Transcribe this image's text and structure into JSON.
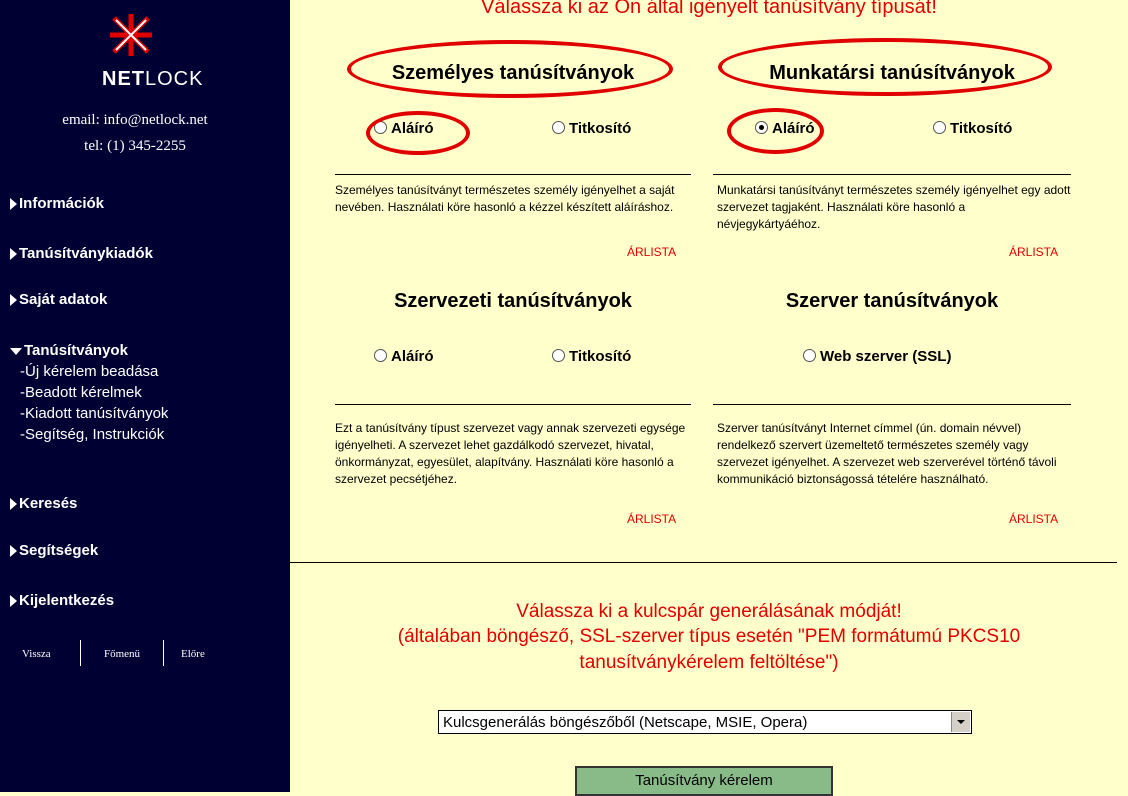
{
  "sidebar": {
    "logo_text_bold": "NET",
    "logo_text_light": "LOCK",
    "email": "email: info@netlock.net",
    "tel": "tel: (1) 345-2255",
    "nav": [
      {
        "label": "Információk"
      },
      {
        "label": "Tanúsítványkiadók"
      },
      {
        "label": "Saját adatok"
      },
      {
        "label": "Tanúsítványok"
      },
      {
        "label": "Keresés"
      },
      {
        "label": "Segítségek"
      },
      {
        "label": "Kijelentkezés"
      }
    ],
    "subnav": [
      {
        "label": "-Új kérelem beadása"
      },
      {
        "label": "-Beadott kérelmek"
      },
      {
        "label": "-Kiadott tanúsítványok"
      },
      {
        "label": "-Segítség, Instrukciók"
      }
    ],
    "bottom": {
      "back": "Vissza",
      "home": "Főmenü",
      "forward": "Előre"
    }
  },
  "main": {
    "heading": "Válassza ki az Ön által igényelt tanúsítvány típusát!",
    "sections": {
      "personal": {
        "title": "Személyes tanúsítványok",
        "opt1": "Aláíró",
        "opt2": "Titkosító",
        "desc": "Személyes tanúsítványt természetes személy igényelhet a saját nevében. Használati köre hasonló a kézzel készített aláíráshoz.",
        "link": "ÁRLISTA"
      },
      "employee": {
        "title": "Munkatársi tanúsítványok",
        "opt1": "Aláíró",
        "opt2": "Titkosító",
        "desc": "Munkatársi tanúsítványt természetes személy igényelhet egy adott szervezet tagjaként. Használati köre hasonló a névjegykártyáéhoz.",
        "link": "ÁRLISTA"
      },
      "org": {
        "title": "Szervezeti tanúsítványok",
        "opt1": "Aláíró",
        "opt2": "Titkosító",
        "desc": "Ezt a tanúsítvány típust szervezet vagy annak szervezeti egysége igényelheti. A szervezet lehet gazdálkodó szervezet, hivatal, önkormányzat, egyesület, alapítvány. Használati köre hasonló a szervezet pecsétjéhez.",
        "link": "ÁRLISTA"
      },
      "server": {
        "title": "Szerver tanúsítványok",
        "opt1": "Web szerver (SSL)",
        "desc": "Szerver tanúsítványt Internet címmel (ún. domain névvel) rendelkező szervert üzemeltető természetes személy vagy szervezet igényelhet. A szervezet web szerverével történő távoli kommunikáció biztonságossá tételére használható.",
        "link": "ÁRLISTA"
      }
    },
    "keygen": {
      "line1": "Válassza ki a kulcspár generálásának módját!",
      "line2": "(általában böngésző, SSL-szerver típus esetén \"PEM formátumú PKCS10",
      "line3": "tanusítványkérelem feltöltése\")",
      "select_value": "Kulcsgenerálás böngészőből (Netscape, MSIE, Opera)",
      "submit": "Tanúsítvány kérelem"
    },
    "colors": {
      "accent": "#e00000",
      "sidebar": "#000033",
      "background": "#ffffcc"
    }
  }
}
